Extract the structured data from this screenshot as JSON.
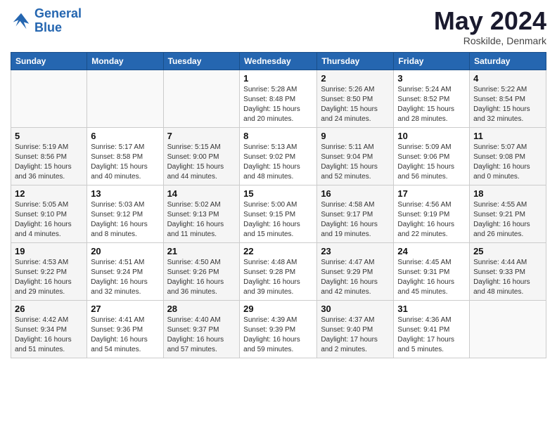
{
  "logo": {
    "line1": "General",
    "line2": "Blue"
  },
  "title": "May 2024",
  "location": "Roskilde, Denmark",
  "weekdays": [
    "Sunday",
    "Monday",
    "Tuesday",
    "Wednesday",
    "Thursday",
    "Friday",
    "Saturday"
  ],
  "weeks": [
    [
      {
        "day": "",
        "info": ""
      },
      {
        "day": "",
        "info": ""
      },
      {
        "day": "",
        "info": ""
      },
      {
        "day": "1",
        "info": "Sunrise: 5:28 AM\nSunset: 8:48 PM\nDaylight: 15 hours\nand 20 minutes."
      },
      {
        "day": "2",
        "info": "Sunrise: 5:26 AM\nSunset: 8:50 PM\nDaylight: 15 hours\nand 24 minutes."
      },
      {
        "day": "3",
        "info": "Sunrise: 5:24 AM\nSunset: 8:52 PM\nDaylight: 15 hours\nand 28 minutes."
      },
      {
        "day": "4",
        "info": "Sunrise: 5:22 AM\nSunset: 8:54 PM\nDaylight: 15 hours\nand 32 minutes."
      }
    ],
    [
      {
        "day": "5",
        "info": "Sunrise: 5:19 AM\nSunset: 8:56 PM\nDaylight: 15 hours\nand 36 minutes."
      },
      {
        "day": "6",
        "info": "Sunrise: 5:17 AM\nSunset: 8:58 PM\nDaylight: 15 hours\nand 40 minutes."
      },
      {
        "day": "7",
        "info": "Sunrise: 5:15 AM\nSunset: 9:00 PM\nDaylight: 15 hours\nand 44 minutes."
      },
      {
        "day": "8",
        "info": "Sunrise: 5:13 AM\nSunset: 9:02 PM\nDaylight: 15 hours\nand 48 minutes."
      },
      {
        "day": "9",
        "info": "Sunrise: 5:11 AM\nSunset: 9:04 PM\nDaylight: 15 hours\nand 52 minutes."
      },
      {
        "day": "10",
        "info": "Sunrise: 5:09 AM\nSunset: 9:06 PM\nDaylight: 15 hours\nand 56 minutes."
      },
      {
        "day": "11",
        "info": "Sunrise: 5:07 AM\nSunset: 9:08 PM\nDaylight: 16 hours\nand 0 minutes."
      }
    ],
    [
      {
        "day": "12",
        "info": "Sunrise: 5:05 AM\nSunset: 9:10 PM\nDaylight: 16 hours\nand 4 minutes."
      },
      {
        "day": "13",
        "info": "Sunrise: 5:03 AM\nSunset: 9:12 PM\nDaylight: 16 hours\nand 8 minutes."
      },
      {
        "day": "14",
        "info": "Sunrise: 5:02 AM\nSunset: 9:13 PM\nDaylight: 16 hours\nand 11 minutes."
      },
      {
        "day": "15",
        "info": "Sunrise: 5:00 AM\nSunset: 9:15 PM\nDaylight: 16 hours\nand 15 minutes."
      },
      {
        "day": "16",
        "info": "Sunrise: 4:58 AM\nSunset: 9:17 PM\nDaylight: 16 hours\nand 19 minutes."
      },
      {
        "day": "17",
        "info": "Sunrise: 4:56 AM\nSunset: 9:19 PM\nDaylight: 16 hours\nand 22 minutes."
      },
      {
        "day": "18",
        "info": "Sunrise: 4:55 AM\nSunset: 9:21 PM\nDaylight: 16 hours\nand 26 minutes."
      }
    ],
    [
      {
        "day": "19",
        "info": "Sunrise: 4:53 AM\nSunset: 9:22 PM\nDaylight: 16 hours\nand 29 minutes."
      },
      {
        "day": "20",
        "info": "Sunrise: 4:51 AM\nSunset: 9:24 PM\nDaylight: 16 hours\nand 32 minutes."
      },
      {
        "day": "21",
        "info": "Sunrise: 4:50 AM\nSunset: 9:26 PM\nDaylight: 16 hours\nand 36 minutes."
      },
      {
        "day": "22",
        "info": "Sunrise: 4:48 AM\nSunset: 9:28 PM\nDaylight: 16 hours\nand 39 minutes."
      },
      {
        "day": "23",
        "info": "Sunrise: 4:47 AM\nSunset: 9:29 PM\nDaylight: 16 hours\nand 42 minutes."
      },
      {
        "day": "24",
        "info": "Sunrise: 4:45 AM\nSunset: 9:31 PM\nDaylight: 16 hours\nand 45 minutes."
      },
      {
        "day": "25",
        "info": "Sunrise: 4:44 AM\nSunset: 9:33 PM\nDaylight: 16 hours\nand 48 minutes."
      }
    ],
    [
      {
        "day": "26",
        "info": "Sunrise: 4:42 AM\nSunset: 9:34 PM\nDaylight: 16 hours\nand 51 minutes."
      },
      {
        "day": "27",
        "info": "Sunrise: 4:41 AM\nSunset: 9:36 PM\nDaylight: 16 hours\nand 54 minutes."
      },
      {
        "day": "28",
        "info": "Sunrise: 4:40 AM\nSunset: 9:37 PM\nDaylight: 16 hours\nand 57 minutes."
      },
      {
        "day": "29",
        "info": "Sunrise: 4:39 AM\nSunset: 9:39 PM\nDaylight: 16 hours\nand 59 minutes."
      },
      {
        "day": "30",
        "info": "Sunrise: 4:37 AM\nSunset: 9:40 PM\nDaylight: 17 hours\nand 2 minutes."
      },
      {
        "day": "31",
        "info": "Sunrise: 4:36 AM\nSunset: 9:41 PM\nDaylight: 17 hours\nand 5 minutes."
      },
      {
        "day": "",
        "info": ""
      }
    ]
  ]
}
